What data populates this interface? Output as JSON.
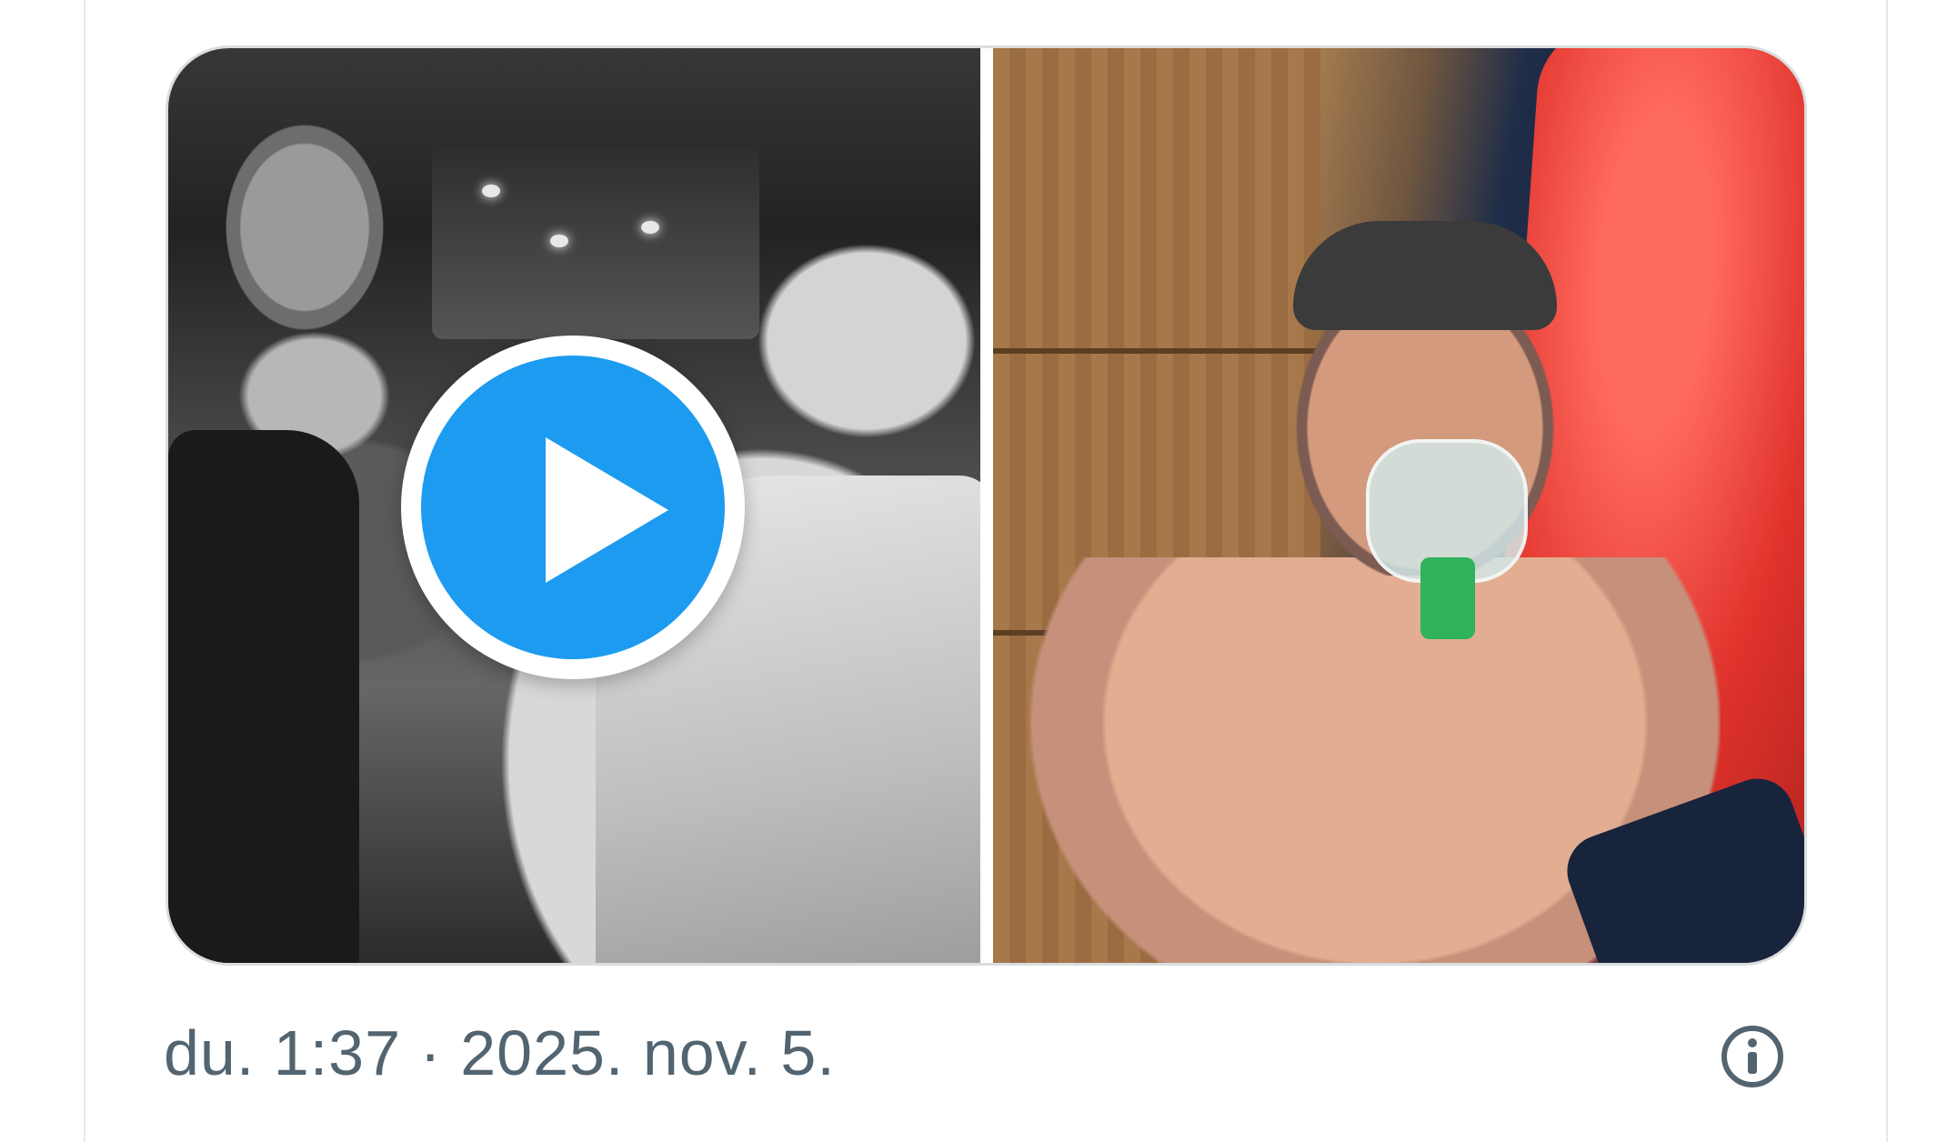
{
  "post": {
    "timestamp": "du. 1:37 · 2025. nov. 5.",
    "media": {
      "video": {
        "play_icon": "play-icon",
        "play_color": "#1d9bf0"
      },
      "photo": {}
    },
    "info_icon": "info-icon"
  },
  "colors": {
    "accent": "#1d9bf0",
    "text_secondary": "#536471",
    "border": "#e6e8ea"
  }
}
